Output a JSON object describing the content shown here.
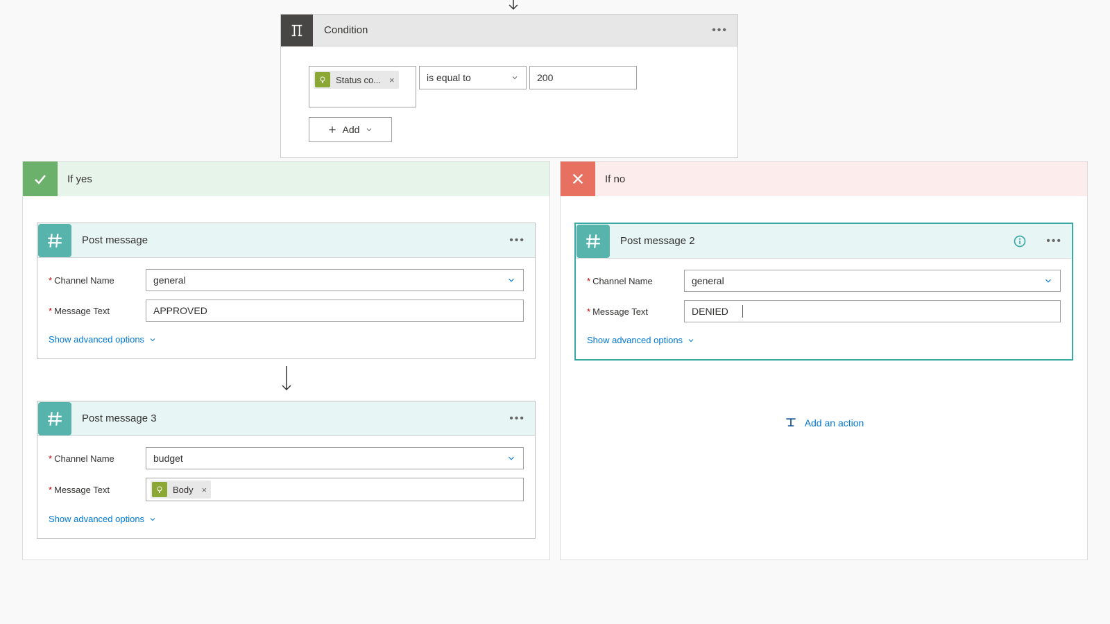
{
  "condition": {
    "title": "Condition",
    "token_label": "Status co...",
    "operator": "is equal to",
    "value": "200",
    "add_label": "Add"
  },
  "yes_branch": {
    "title": "If yes",
    "cards": [
      {
        "title": "Post message",
        "channel_label": "Channel Name",
        "channel_value": "general",
        "message_label": "Message Text",
        "message_value": "APPROVED",
        "adv": "Show advanced options"
      },
      {
        "title": "Post message 3",
        "channel_label": "Channel Name",
        "channel_value": "budget",
        "message_label": "Message Text",
        "token_label": "Body",
        "adv": "Show advanced options"
      }
    ]
  },
  "no_branch": {
    "title": "If no",
    "card": {
      "title": "Post message 2",
      "channel_label": "Channel Name",
      "channel_value": "general",
      "message_label": "Message Text",
      "message_value": "DENIED",
      "adv": "Show advanced options"
    },
    "add_action": "Add an action"
  }
}
